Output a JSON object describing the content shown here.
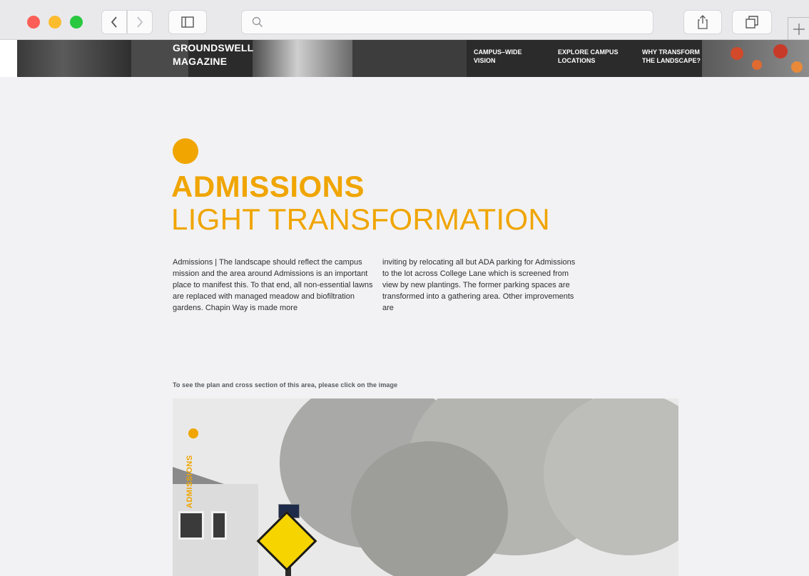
{
  "browser": {
    "back_icon": "chevron-left-icon",
    "forward_icon": "chevron-right-icon",
    "sidebar_icon": "sidebar-icon",
    "search_icon": "search-icon",
    "share_icon": "share-icon",
    "tabs_icon": "tabs-icon",
    "new_tab_icon": "plus-icon",
    "address_value": ""
  },
  "header": {
    "logo_line1": "GROUNDSWELL",
    "logo_line2": "MAGAZINE",
    "nav": [
      {
        "line1": "CAMPUS–WIDE",
        "line2": "VISION"
      },
      {
        "line1": "EXPLORE CAMPUS",
        "line2": "LOCATIONS"
      },
      {
        "line1": "WHY TRANSFORM",
        "line2": "THE LANDSCAPE?"
      }
    ]
  },
  "main": {
    "title": "ADMISSIONS",
    "subtitle": "LIGHT TRANSFORMATION",
    "body_col1": "Admissions | The landscape should reflect the campus mission and the area around Admissions is an important place to manifest this.  To that end, all non-essential lawns are replaced with managed meadow and biofiltration gardens.  Chapin Way is made more",
    "body_col2": "inviting by relocating all but ADA parking for Admissions to the lot across College Lane which is screened from view by new plantings. The former parking spaces are transformed into a gathering area.  Other improvements are",
    "hint": "To see the plan and cross section of this area, please click on the image",
    "image_label": "ADMISSIONS"
  },
  "colors": {
    "accent": "#f0a500",
    "header_bg": "#2b2b2b",
    "page_bg": "#f2f2f4"
  }
}
